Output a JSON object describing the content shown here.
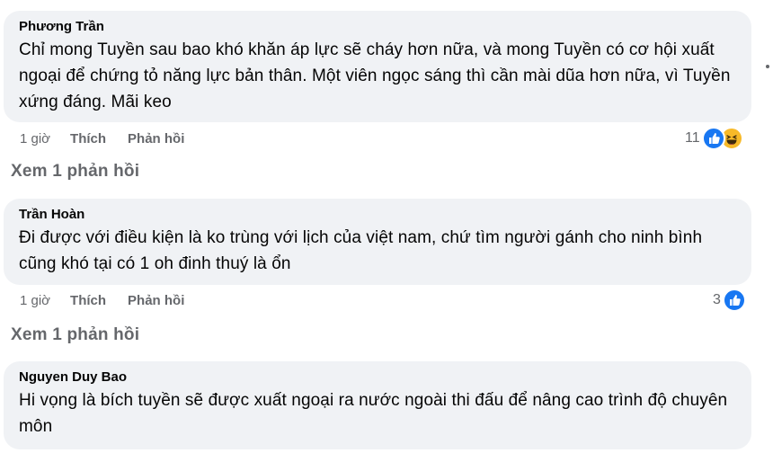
{
  "comments": [
    {
      "author": "Phương Trần",
      "text": "Chỉ mong Tuyền sau bao khó khăn áp lực sẽ cháy hơn nữa, và mong Tuyền có cơ hội xuất ngoại để chứng tỏ năng lực bản thân. Một viên ngọc sáng thì cần mài dũa hơn nữa, vì Tuyền xứng đáng. Mãi keo",
      "time": "1 giờ",
      "like_label": "Thích",
      "reply_label": "Phản hồi",
      "reaction_count": "11",
      "reactions": [
        "like-icon",
        "haha-icon"
      ]
    },
    {
      "author": "Trần Hoàn",
      "text": "Đi được với điều kiện là ko trùng với lịch của việt nam, chứ tìm người gánh cho ninh bình cũng khó tại có 1 oh đinh thuý là ổn",
      "time": "1 giờ",
      "like_label": "Thích",
      "reply_label": "Phản hồi",
      "reaction_count": "3",
      "reactions": [
        "like-icon"
      ]
    },
    {
      "author": "Nguyen Duy Bao",
      "text": "Hi vọng là bích tuyền sẽ được xuất ngoại ra nước ngoài thi đấu để nâng cao trình độ chuyên môn"
    }
  ],
  "view_replies": [
    "Xem 1 phản hồi",
    "Xem 1 phản hồi"
  ],
  "colors": {
    "bubble": "#f0f2f5",
    "like": "#1877f2",
    "haha": "#f7b928",
    "secondary_text": "#65676b"
  }
}
